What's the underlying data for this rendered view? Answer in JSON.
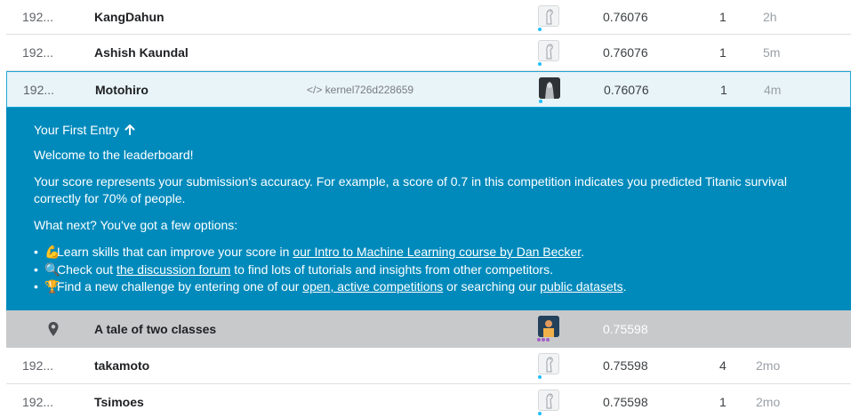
{
  "rows_top": [
    {
      "rank": "192...",
      "name": "KangDahun",
      "kernel": "",
      "score": "0.76076",
      "entries": "1",
      "last": "2h"
    },
    {
      "rank": "192...",
      "name": "Ashish Kaundal",
      "kernel": "",
      "score": "0.76076",
      "entries": "1",
      "last": "5m"
    },
    {
      "rank": "192...",
      "name": "Motohiro",
      "kernel": "</> kernel726d228659",
      "score": "0.76076",
      "entries": "1",
      "last": "4m"
    }
  ],
  "panel": {
    "heading": "Your First Entry",
    "heading_icon": "arrow-up-icon",
    "welcome": "Welcome to the leaderboard!",
    "explanation": "Your score represents your submission's accuracy. For example, a score of 0.7 in this competition indicates you predicted Titanic survival correctly for 70% of people.",
    "next": "What next? You've got a few options:",
    "options": [
      {
        "emoji": "💪",
        "before": "Learn skills that can improve your score in ",
        "link": "our Intro to Machine Learning course by Dan Becker",
        "after": "."
      },
      {
        "emoji": "🔍",
        "before": "Check out ",
        "link": "the discussion forum",
        "after": " to find lots of tutorials and insights from other competitors."
      },
      {
        "emoji": "🏆",
        "before": "Find a new challenge by entering one of our ",
        "link": "open, active competitions",
        "middle": " or searching our ",
        "link2": "public datasets",
        "after": "."
      }
    ]
  },
  "team_row": {
    "icon": "location-pin-icon",
    "name": "A tale of two classes",
    "score": "0.75598"
  },
  "rows_bottom": [
    {
      "rank": "192...",
      "name": "takamoto",
      "score": "0.75598",
      "entries": "4",
      "last": "2mo"
    },
    {
      "rank": "192...",
      "name": "Tsimoes",
      "score": "0.75598",
      "entries": "1",
      "last": "2mo"
    }
  ],
  "colors": {
    "panel": "#008abc",
    "highlight_border": "#20a7d8",
    "team_row": "#c8c9cb",
    "tier_dot": "#20beff"
  }
}
